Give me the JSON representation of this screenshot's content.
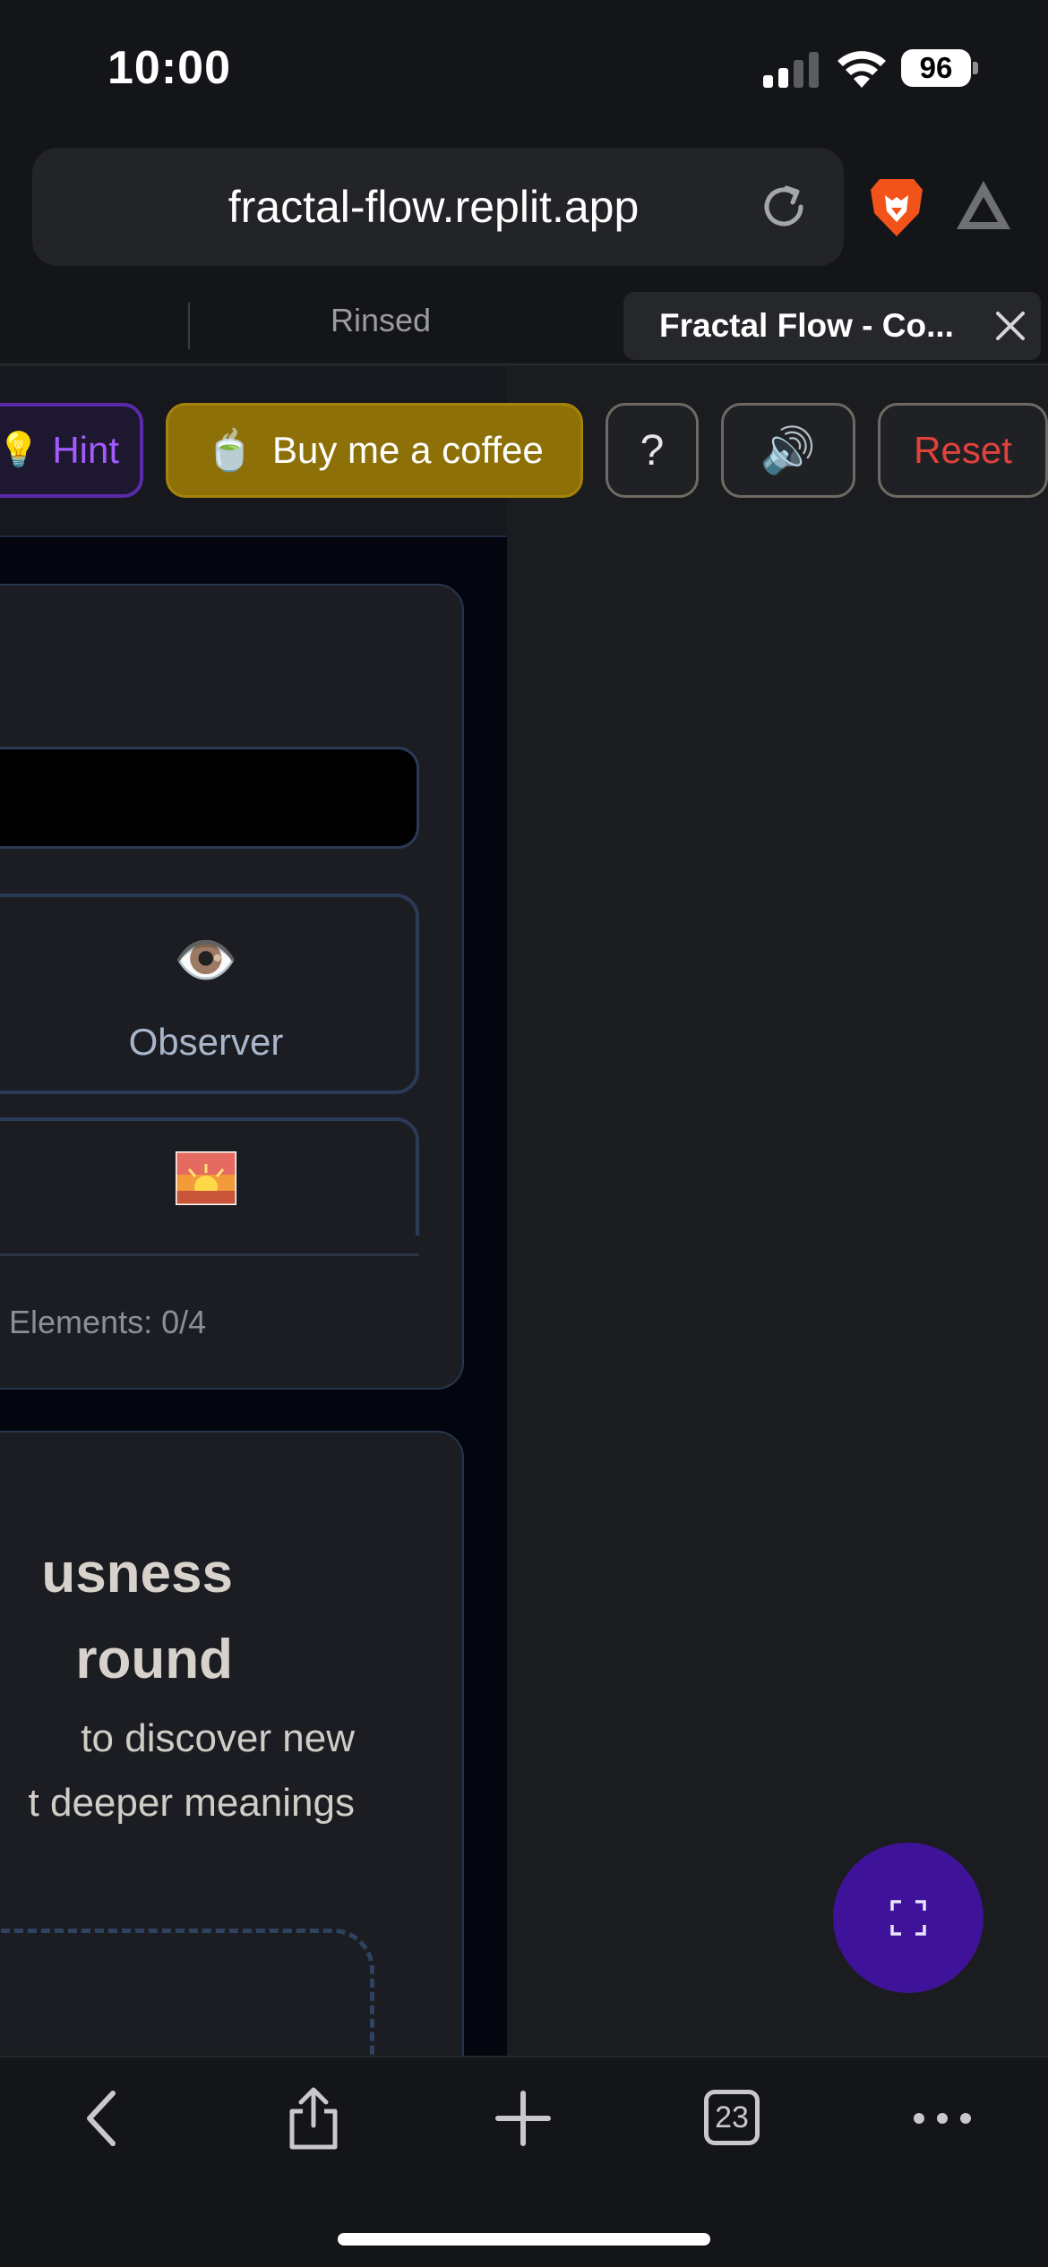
{
  "status_bar": {
    "time": "10:00",
    "battery": "96"
  },
  "browser": {
    "url": "fractal-flow.replit.app",
    "tabs": [
      {
        "label": "Rinsed",
        "active": false
      },
      {
        "label": "Fractal Flow - Co...",
        "active": true
      }
    ],
    "open_tab_count": "23"
  },
  "header": {
    "hint_icon": "💡",
    "hint_label": "Hint",
    "coffee_icon": "🍵",
    "coffee_label": "Buy me a coffee",
    "help_label": "?",
    "sound_icon": "🔊",
    "reset_label": "Reset"
  },
  "elements_card": {
    "tiles": [
      {
        "emoji": "👁️",
        "label": "Observer"
      },
      {
        "emoji": "🌅",
        "label": ""
      }
    ],
    "counter": "Elements: 0/4"
  },
  "playground_card": {
    "title_lines": [
      "usness",
      "round"
    ],
    "description_lines": [
      "to discover new",
      "t deeper meanings"
    ]
  },
  "colors": {
    "accent_purple": "#3f129a",
    "coffee_gold": "#8d7108",
    "reset_red": "#e0423c",
    "hint_purple": "#a35bff"
  },
  "icons": {
    "reload": "reload-icon",
    "brave": "brave-lion-icon",
    "aurora": "aurora-triangle-icon",
    "close": "close-icon",
    "fullscreen": "fullscreen-icon",
    "back": "back-chevron-icon",
    "share": "share-icon",
    "new_tab": "plus-icon",
    "tabs": "tabs-icon",
    "more": "more-icon"
  }
}
